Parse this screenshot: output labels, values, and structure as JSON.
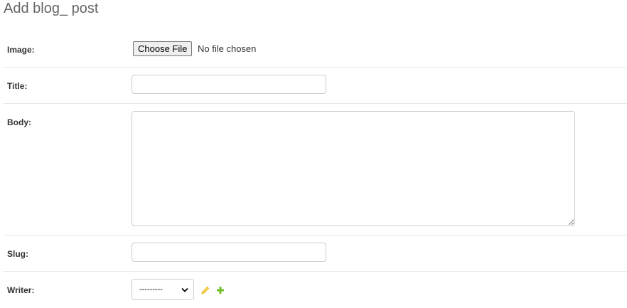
{
  "page": {
    "title": "Add blog_ post"
  },
  "fields": {
    "image": {
      "label": "Image:",
      "button_label": "Choose File",
      "status": "No file chosen"
    },
    "title": {
      "label": "Title:",
      "value": ""
    },
    "body": {
      "label": "Body:",
      "value": ""
    },
    "slug": {
      "label": "Slug:",
      "value": ""
    },
    "writer": {
      "label": "Writer:",
      "selected": "---------",
      "edit_icon": "pencil-icon",
      "add_icon": "plus-icon"
    }
  },
  "colors": {
    "accent_green": "#70bf2b",
    "pencil_yellow": "#efb80b",
    "divider": "#e8e8e8",
    "title_gray": "#666666"
  }
}
